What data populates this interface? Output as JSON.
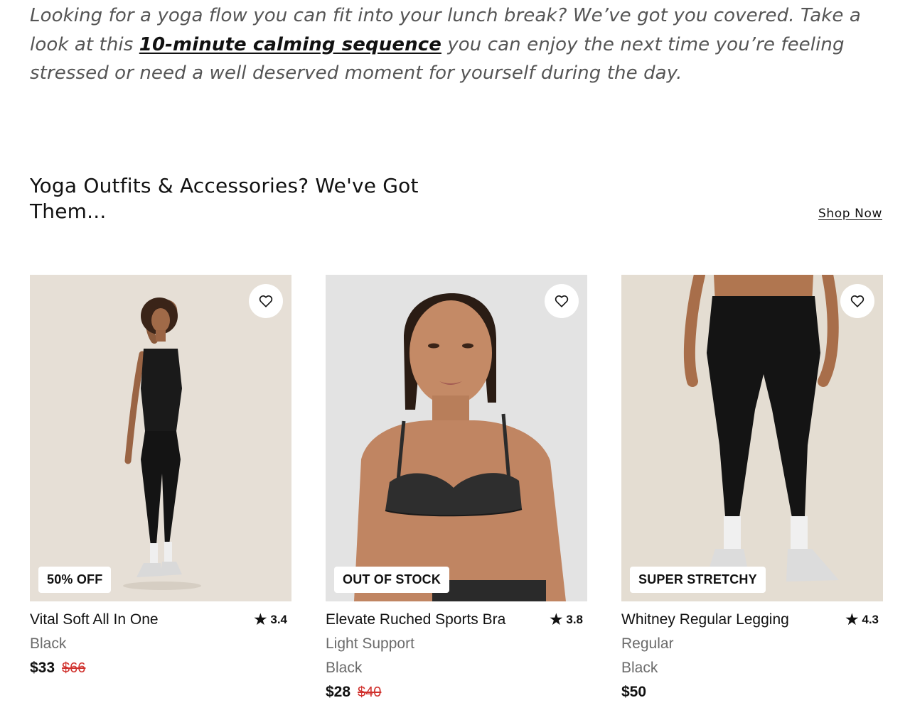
{
  "intro": {
    "before": "Looking for a yoga flow you can fit into your lunch break? We’ve got you covered. Take a look at this ",
    "link": "10-minute calming sequence",
    "after": " you can enjoy the next time you’re feeling stressed or need a well deserved moment for yourself during the day."
  },
  "section": {
    "title": "Yoga Outfits & Accessories? We've Got Them...",
    "shop_now": "Shop Now"
  },
  "products": [
    {
      "badge": "50% OFF",
      "name": "Vital Soft All In One",
      "rating": "3.4",
      "meta1": "Black",
      "meta2": "",
      "price": "$33",
      "was": "$66",
      "bg": "#e6dfd6"
    },
    {
      "badge": "OUT OF STOCK",
      "name": "Elevate Ruched Sports Bra",
      "rating": "3.8",
      "meta1": "Light Support",
      "meta2": "Black",
      "price": "$28",
      "was": "$40",
      "bg": "#e3e3e3"
    },
    {
      "badge": "SUPER STRETCHY",
      "name": "Whitney Regular Legging",
      "rating": "4.3",
      "meta1": "Regular",
      "meta2": "Black",
      "price": "$50",
      "was": "",
      "bg": "#e4ddd2"
    }
  ],
  "icons": {
    "wishlist": "heart-outline-icon",
    "rating": "star-icon"
  },
  "colors": {
    "sale_price": "#d0312d",
    "muted_text": "#6b6b6b"
  }
}
